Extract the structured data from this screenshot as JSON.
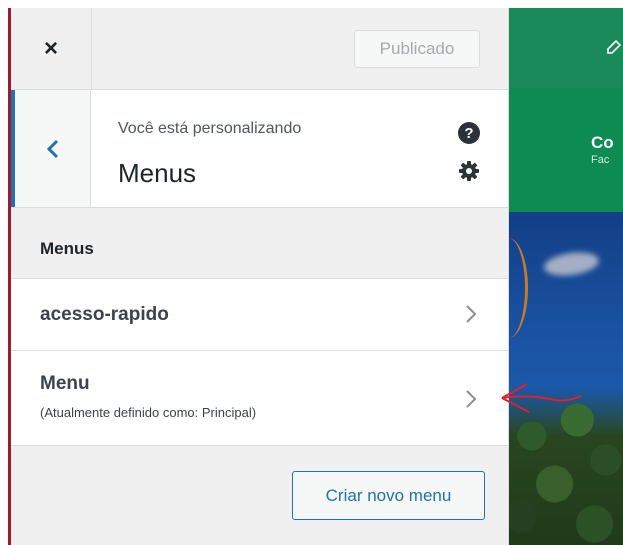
{
  "header": {
    "close_label": "×",
    "publish_label": "Publicado"
  },
  "customizing": {
    "label": "Você está personalizando",
    "title": "Menus",
    "help_glyph": "?"
  },
  "section": {
    "title": "Menus"
  },
  "menus": [
    {
      "name": "acesso-rapido"
    },
    {
      "name": "Menu",
      "subtitle": "(Atualmente definido como: Principal)"
    }
  ],
  "create_button": "Criar novo menu",
  "preview": {
    "title_fragment": "Co",
    "sub_fragment": "Fac"
  },
  "colors": {
    "accent": "#2271b1",
    "annotation": "#e0202a",
    "preview_green": "#0c8b52"
  }
}
